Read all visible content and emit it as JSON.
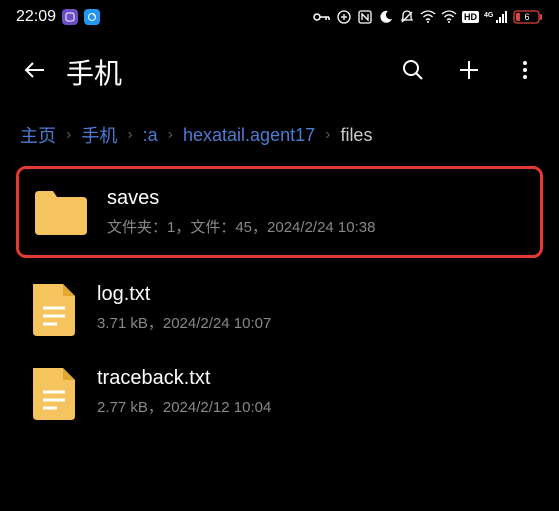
{
  "status": {
    "time": "22:09",
    "battery": "6"
  },
  "header": {
    "title": "手机"
  },
  "breadcrumb": {
    "items": [
      {
        "label": "主页"
      },
      {
        "label": "手机"
      },
      {
        "label": ":a"
      },
      {
        "label": "hexatail.agent17"
      },
      {
        "label": "files"
      }
    ]
  },
  "files": [
    {
      "name": "saves",
      "type": "folder",
      "meta": "文件夹：1，文件：45，2024/2/24 10:38",
      "highlighted": true
    },
    {
      "name": "log.txt",
      "type": "document",
      "meta": "3.71 kB，2024/2/24 10:07",
      "highlighted": false
    },
    {
      "name": "traceback.txt",
      "type": "document",
      "meta": "2.77 kB，2024/2/12 10:04",
      "highlighted": false
    }
  ]
}
